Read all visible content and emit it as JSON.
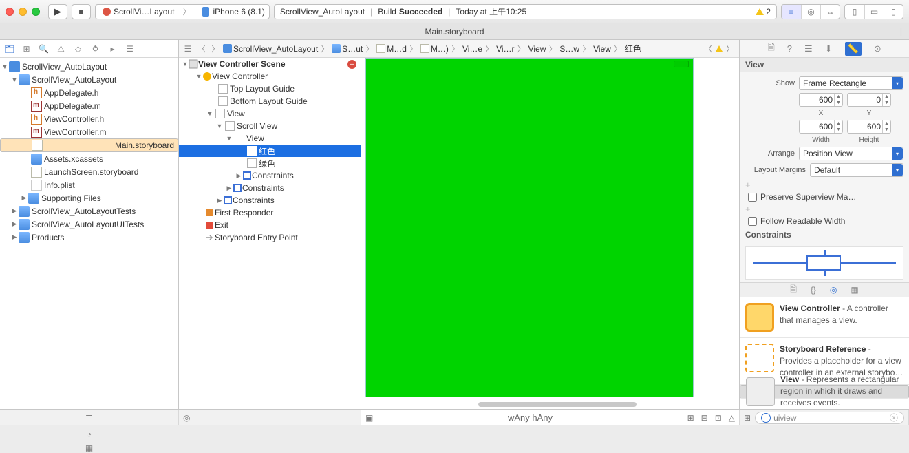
{
  "toolbar": {
    "scheme_project": "ScrollVi…Layout",
    "scheme_device": "iPhone 6 (8.1)",
    "status_project": "ScrollView_AutoLayout",
    "status_build": "Build",
    "status_result": "Succeeded",
    "status_time": "Today at 上午10:25",
    "warning_count": "2"
  },
  "tabbar": {
    "tab1": "Main.storyboard"
  },
  "navigator": {
    "root": "ScrollView_AutoLayout",
    "group1": "ScrollView_AutoLayout",
    "files": {
      "appdel_h": "AppDelegate.h",
      "appdel_m": "AppDelegate.m",
      "vc_h": "ViewController.h",
      "vc_m": "ViewController.m",
      "main_sb": "Main.storyboard",
      "assets": "Assets.xcassets",
      "launch": "LaunchScreen.storyboard",
      "info": "Info.plist",
      "supporting": "Supporting Files"
    },
    "tests": "ScrollView_AutoLayoutTests",
    "uitests": "ScrollView_AutoLayoutUITests",
    "products": "Products"
  },
  "jumpbar": {
    "p0": "ScrollView_AutoLayout",
    "p1": "S…ut",
    "p2": "M…d",
    "p3": "M…)",
    "p4": "Vi…e",
    "p5": "Vi…r",
    "p6": "View",
    "p7": "S…w",
    "p8": "View",
    "p9": "红色"
  },
  "outline": {
    "scene": "View Controller Scene",
    "vc": "View Controller",
    "top_guide": "Top Layout Guide",
    "bottom_guide": "Bottom Layout Guide",
    "view": "View",
    "scroll": "Scroll View",
    "inner_view": "View",
    "red": "红色",
    "green": "绿色",
    "constraints": "Constraints",
    "first_responder": "First Responder",
    "exit": "Exit",
    "entry": "Storyboard Entry Point"
  },
  "inspector": {
    "header": "View",
    "show_label": "Show",
    "show_value": "Frame Rectangle",
    "x": "600",
    "y": "0",
    "xl": "X",
    "yl": "Y",
    "w": "600",
    "h": "600",
    "wl": "Width",
    "hl": "Height",
    "arrange_label": "Arrange",
    "arrange_value": "Position View",
    "margins_label": "Layout Margins",
    "margins_value": "Default",
    "preserve": "Preserve Superview Ma…",
    "readable": "Follow Readable Width",
    "constraints_h": "Constraints"
  },
  "library": {
    "vc_title": "View Controller",
    "vc_desc": " - A controller that manages a view.",
    "sb_title": "Storyboard Reference",
    "sb_desc": " - Provides a placeholder for a view controller in an external storybo…",
    "view_title": "View",
    "view_desc": " - Represents a rectangular region in which it draws and receives events.",
    "filter": "uiview"
  },
  "footer": {
    "size_class": "wAny  hAny"
  }
}
